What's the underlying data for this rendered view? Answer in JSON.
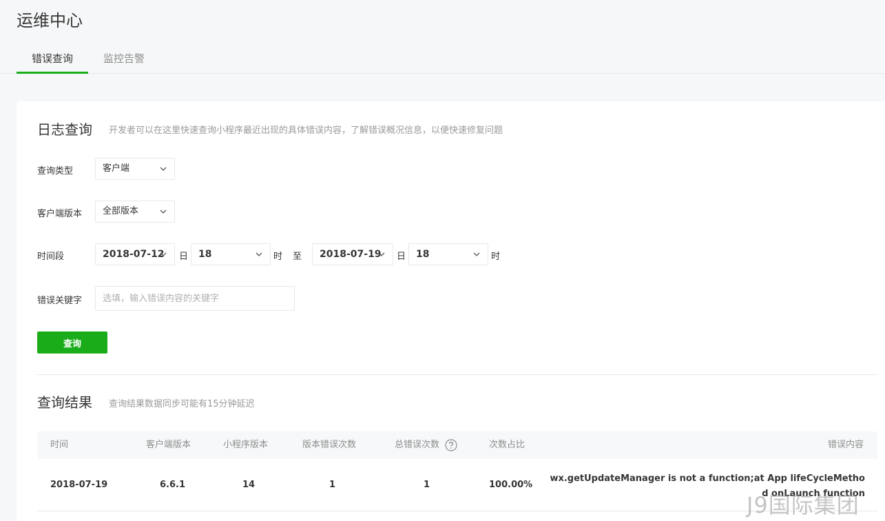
{
  "page": {
    "title": "运维中心"
  },
  "tabs": [
    {
      "label": "错误查询",
      "active": true
    },
    {
      "label": "监控告警",
      "active": false
    }
  ],
  "log_query": {
    "title": "日志查询",
    "description": "开发者可以在这里快速查询小程序最近出现的具体错误内容，了解错误概况信息，以便快速修复问题",
    "query_type": {
      "label": "查询类型",
      "value": "客户端"
    },
    "client_version": {
      "label": "客户端版本",
      "value": "全部版本"
    },
    "time_range": {
      "label": "时间段",
      "start_date": "2018-07-12",
      "day_unit": "日",
      "start_hour": "18",
      "hour_unit": "时",
      "to_label": "至",
      "end_date": "2018-07-19",
      "end_hour": "18"
    },
    "keyword": {
      "label": "错误关键字",
      "placeholder": "选填，输入错误内容的关键字",
      "value": ""
    },
    "submit_label": "查询"
  },
  "results": {
    "title": "查询结果",
    "description": "查询结果数据同步可能有15分钟延迟",
    "columns": [
      "时间",
      "客户端版本",
      "小程序版本",
      "版本错误次数",
      "总错误次数",
      "次数占比",
      "错误内容"
    ],
    "rows": [
      {
        "time": "2018-07-19",
        "client_version": "6.6.1",
        "app_version": "14",
        "version_errors": "1",
        "total_errors": "1",
        "ratio": "100.00%",
        "error": "wx.getUpdateManager is not a function;at App lifeCycleMethod onLaunch function"
      }
    ]
  },
  "watermark": "J9国际集团",
  "colors": {
    "accent": "#1aad19",
    "text": "#353535",
    "muted": "#8d8d8d"
  }
}
